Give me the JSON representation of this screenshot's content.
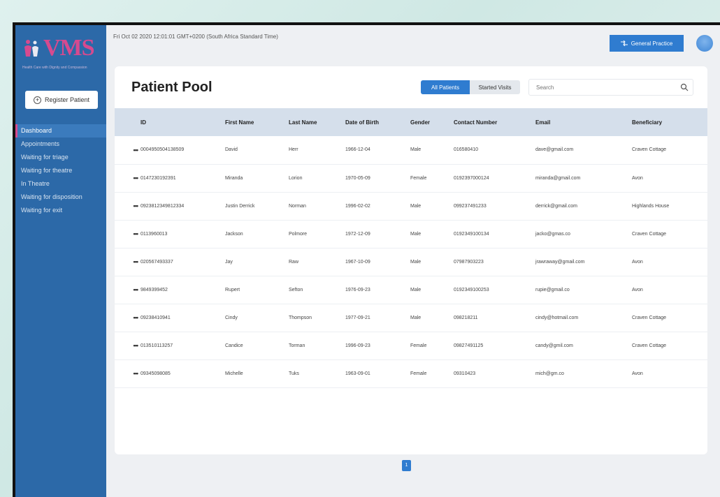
{
  "app": {
    "logo_text": "VMS",
    "tagline": "Health Care with Dignity and Compassion"
  },
  "sidebar": {
    "register_label": "Register Patient",
    "items": [
      {
        "label": "Dashboard",
        "active": true
      },
      {
        "label": "Appointments"
      },
      {
        "label": "Waiting for triage"
      },
      {
        "label": "Waiting for theatre"
      },
      {
        "label": "In Theatre"
      },
      {
        "label": "Waiting for disposition"
      },
      {
        "label": "Waiting for exit"
      }
    ]
  },
  "topbar": {
    "datetime": "Fri Oct 02 2020 12:01:01 GMT+0200 (South Africa Standard Time)",
    "practice_button": "General Practice"
  },
  "page": {
    "title": "Patient Pool",
    "filters": {
      "all": "All Patients",
      "started": "Started Visits"
    },
    "search_placeholder": "Search"
  },
  "table": {
    "columns": [
      "ID",
      "First Name",
      "Last Name",
      "Date of Birth",
      "Gender",
      "Contact Number",
      "Email",
      "Beneficiary"
    ],
    "rows": [
      {
        "id": "0004950504138509",
        "first": "David",
        "last": "Herr",
        "dob": "1966-12-04",
        "gender": "Male",
        "contact": "016580410",
        "email": "dave@gmail.com",
        "beneficiary": "Craven Cottage"
      },
      {
        "id": "0147230192391",
        "first": "Miranda",
        "last": "Lorion",
        "dob": "1970-05-09",
        "gender": "Female",
        "contact": "0192397000124",
        "email": "miranda@gmail.com",
        "beneficiary": "Avon"
      },
      {
        "id": "0923812349812334",
        "first": "Justin Derrick",
        "last": "Norman",
        "dob": "1996-02-02",
        "gender": "Male",
        "contact": "099237491233",
        "email": "derrick@gmail.com",
        "beneficiary": "Highlands House"
      },
      {
        "id": "0113960013",
        "first": "Jackson",
        "last": "Polmore",
        "dob": "1972-12-09",
        "gender": "Male",
        "contact": "0192349100134",
        "email": "jacko@gmas.co",
        "beneficiary": "Craven Cottage"
      },
      {
        "id": "020567493337",
        "first": "Jay",
        "last": "Raw",
        "dob": "1967-10-09",
        "gender": "Male",
        "contact": "07987903223",
        "email": "jrawraway@gmail.com",
        "beneficiary": "Avon"
      },
      {
        "id": "9849399452",
        "first": "Rupert",
        "last": "Sefton",
        "dob": "1976-09-23",
        "gender": "Male",
        "contact": "0192349100253",
        "email": "rupie@gmail.co",
        "beneficiary": "Avon"
      },
      {
        "id": "09238410941",
        "first": "Cindy",
        "last": "Thompson",
        "dob": "1977-09-21",
        "gender": "Male",
        "contact": "098218211",
        "email": "cindy@hotmail.com",
        "beneficiary": "Craven Cottage"
      },
      {
        "id": "013510113257",
        "first": "Candice",
        "last": "Torman",
        "dob": "1996-09-23",
        "gender": "Female",
        "contact": "09827491125",
        "email": "candy@gmil.com",
        "beneficiary": "Craven Cottage"
      },
      {
        "id": "09345098085",
        "first": "Michelle",
        "last": "Tuks",
        "dob": "1963-09-01",
        "gender": "Female",
        "contact": "09310423",
        "email": "mich@gm.co",
        "beneficiary": "Avon"
      }
    ]
  },
  "pagination": {
    "current": "1"
  },
  "colors": {
    "sidebar": "#2c69a8",
    "accent": "#2f7cd0",
    "brand": "#d64a8f",
    "header_row": "#d5dfeb"
  }
}
